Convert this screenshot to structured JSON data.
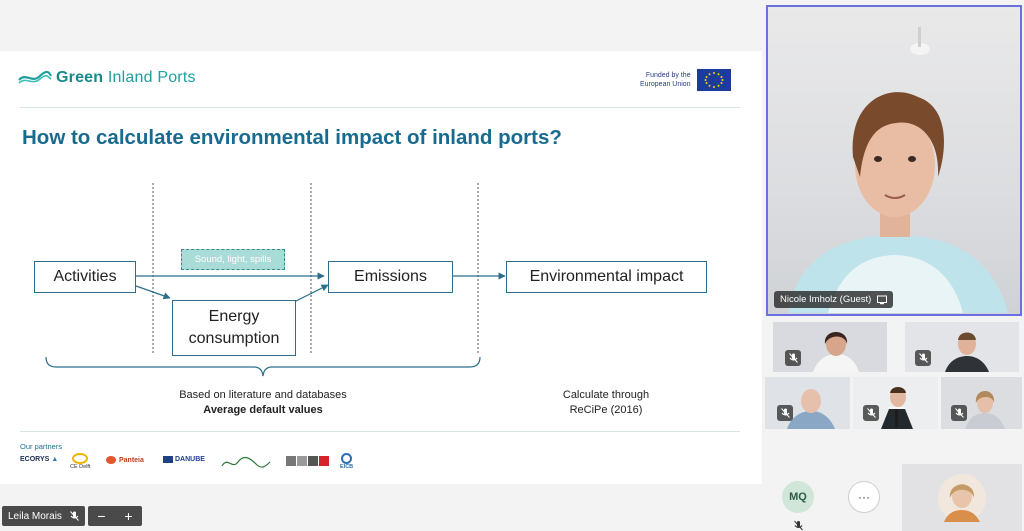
{
  "slide": {
    "logo": {
      "bold": "Green",
      "rest": " Inland Ports"
    },
    "eu": {
      "line1": "Funded by the",
      "line2": "European Union"
    },
    "title": "How to calculate environmental impact of inland ports?",
    "diagram": {
      "activities": "Activities",
      "energy_line1": "Energy",
      "energy_line2": "consumption",
      "sound": "Sound, light, spills",
      "emissions": "Emissions",
      "impact": "Environmental impact",
      "caption_left_1": "Based on literature and databases",
      "caption_left_2": "Average default values",
      "caption_right_1": "Calculate through",
      "caption_right_2": "ReCiPe (2016)"
    },
    "partners": {
      "title": "Our partners",
      "ecorys": "ECORYS",
      "cedelft": "CE Delft",
      "panteia": "Panteia",
      "danube": "DANUBE",
      "eicb": "EICB"
    }
  },
  "meeting": {
    "speaker_name": "Nicole Imholz (Guest)",
    "participant_initials": "MQ",
    "more_label": "···",
    "self_name": "Leila Morais",
    "zoom_minus": "−",
    "zoom_plus": "+"
  },
  "colors": {
    "accent": "#186b8f",
    "speaker_border": "#6b6fe0",
    "brand_teal": "#1f9f9f"
  }
}
